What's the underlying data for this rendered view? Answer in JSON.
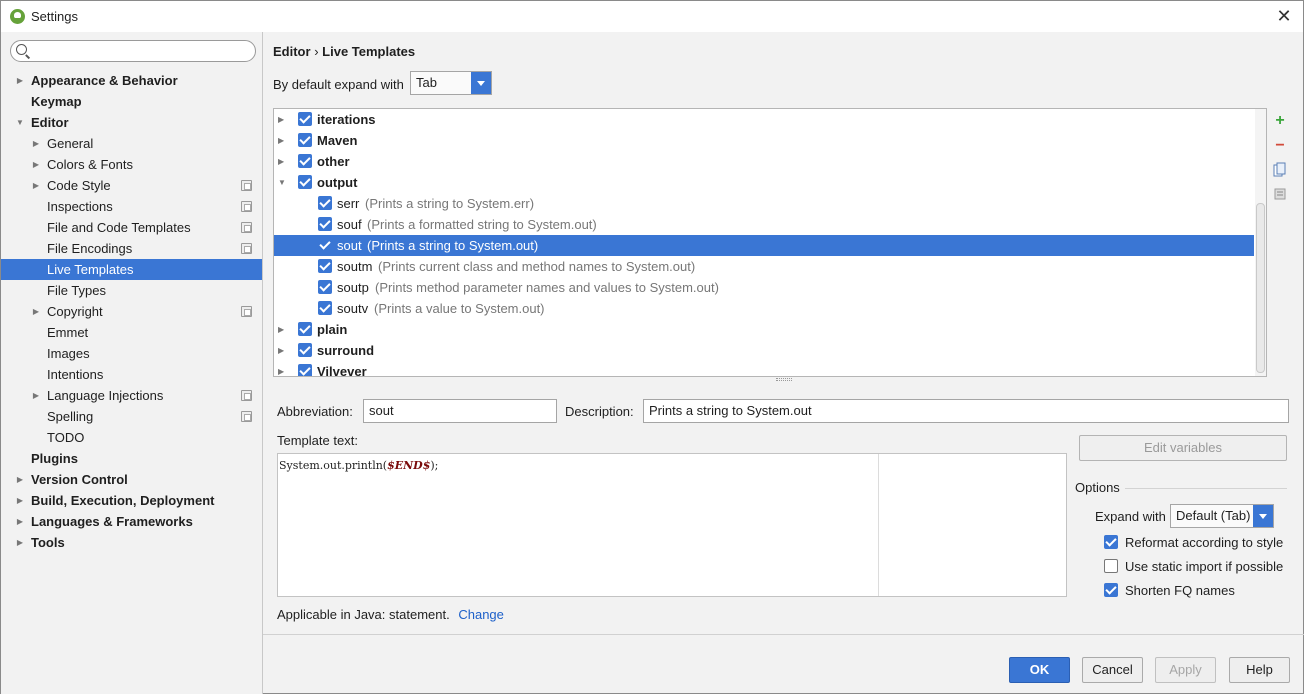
{
  "window": {
    "title": "Settings",
    "close": "✕"
  },
  "search": {
    "placeholder": "",
    "value": ""
  },
  "sidebar": {
    "items": [
      {
        "label": "Appearance & Behavior"
      },
      {
        "label": "Keymap"
      },
      {
        "label": "Editor"
      },
      {
        "label": "General"
      },
      {
        "label": "Colors & Fonts"
      },
      {
        "label": "Code Style"
      },
      {
        "label": "Inspections"
      },
      {
        "label": "File and Code Templates"
      },
      {
        "label": "File Encodings"
      },
      {
        "label": "Live Templates"
      },
      {
        "label": "File Types"
      },
      {
        "label": "Copyright"
      },
      {
        "label": "Emmet"
      },
      {
        "label": "Images"
      },
      {
        "label": "Intentions"
      },
      {
        "label": "Language Injections"
      },
      {
        "label": "Spelling"
      },
      {
        "label": "TODO"
      },
      {
        "label": "Plugins"
      },
      {
        "label": "Version Control"
      },
      {
        "label": "Build, Execution, Deployment"
      },
      {
        "label": "Languages & Frameworks"
      },
      {
        "label": "Tools"
      }
    ]
  },
  "breadcrumb": {
    "parent": "Editor",
    "sep": "›",
    "current": "Live Templates"
  },
  "expand": {
    "label": "By default expand with",
    "value": "Tab"
  },
  "templates": {
    "rows": [
      {
        "name": "iterations",
        "desc": ""
      },
      {
        "name": "Maven",
        "desc": ""
      },
      {
        "name": "other",
        "desc": ""
      },
      {
        "name": "output",
        "desc": ""
      },
      {
        "name": "serr",
        "desc": "(Prints a string to System.err)"
      },
      {
        "name": "souf",
        "desc": "(Prints a formatted string to System.out)"
      },
      {
        "name": "sout",
        "desc": "(Prints a string to System.out)"
      },
      {
        "name": "soutm",
        "desc": "(Prints current class and method names to System.out)"
      },
      {
        "name": "soutp",
        "desc": "(Prints method parameter names and values to System.out)"
      },
      {
        "name": "soutv",
        "desc": "(Prints a value to System.out)"
      },
      {
        "name": "plain",
        "desc": ""
      },
      {
        "name": "surround",
        "desc": ""
      },
      {
        "name": "Vilvever",
        "desc": ""
      }
    ]
  },
  "toolbar": {
    "add": "+",
    "remove": "−"
  },
  "editor": {
    "abbreviation_label": "Abbreviation:",
    "abbreviation_value": "sout",
    "description_label": "Description:",
    "description_value": "Prints a string to System.out",
    "template_label": "Template text:",
    "code_prefix": "System.out.println(",
    "code_var": "$END$",
    "code_suffix": ");",
    "edit_variables": "Edit variables",
    "applicable": "Applicable in Java: statement.",
    "change": "Change"
  },
  "options": {
    "title": "Options",
    "expand_label": "Expand with",
    "expand_value": "Default (Tab)",
    "reformat": "Reformat according to style",
    "static_import": "Use static import if possible",
    "shorten": "Shorten FQ names"
  },
  "buttons": {
    "ok": "OK",
    "cancel": "Cancel",
    "apply": "Apply",
    "help": "Help"
  }
}
